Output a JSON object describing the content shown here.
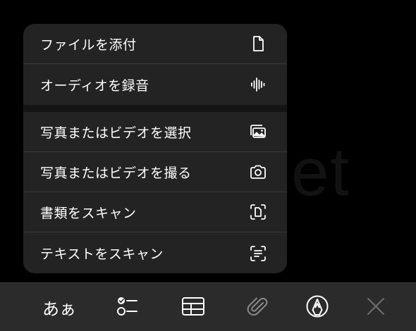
{
  "watermark": "ebapp.net",
  "menu": {
    "items": [
      {
        "label": "ファイルを添付",
        "icon": "document-icon"
      },
      {
        "label": "オーディオを録音",
        "icon": "waveform-icon"
      },
      {
        "label": "写真またはビデオを選択",
        "icon": "photo-library-icon"
      },
      {
        "label": "写真またはビデオを撮る",
        "icon": "camera-icon"
      },
      {
        "label": "書類をスキャン",
        "icon": "document-scan-icon"
      },
      {
        "label": "テキストをスキャン",
        "icon": "text-scan-icon"
      }
    ]
  },
  "toolbar": {
    "format_label": "あぁ",
    "buttons": [
      {
        "name": "format-text",
        "icon": "text-format-icon"
      },
      {
        "name": "checklist",
        "icon": "checklist-icon"
      },
      {
        "name": "table",
        "icon": "table-icon"
      },
      {
        "name": "attachment",
        "icon": "paperclip-icon",
        "state": "active"
      },
      {
        "name": "markup",
        "icon": "pen-tip-icon"
      },
      {
        "name": "close",
        "icon": "close-icon",
        "state": "disabled"
      }
    ]
  },
  "colors": {
    "background": "#000000",
    "menu_background": "#232323",
    "separator": "#3a3a3a",
    "toolbar_background": "#2b2b2b",
    "text": "#ffffff",
    "inactive_icon": "#7a7a7a"
  }
}
